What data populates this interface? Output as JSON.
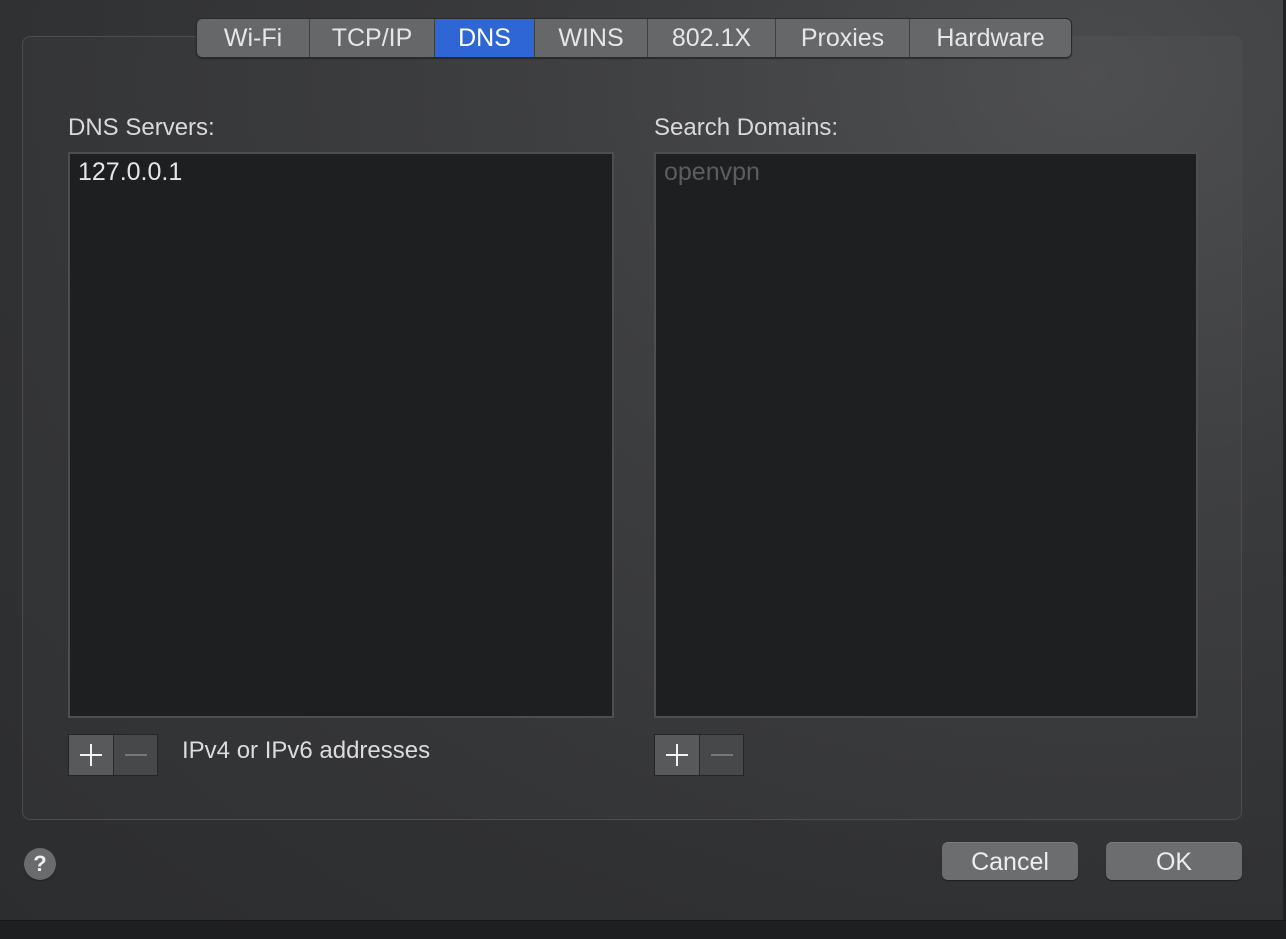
{
  "tabs": [
    {
      "label": "Wi-Fi",
      "active": false
    },
    {
      "label": "TCP/IP",
      "active": false
    },
    {
      "label": "DNS",
      "active": true
    },
    {
      "label": "WINS",
      "active": false
    },
    {
      "label": "802.1X",
      "active": false
    },
    {
      "label": "Proxies",
      "active": false
    },
    {
      "label": "Hardware",
      "active": false
    }
  ],
  "dns": {
    "label": "DNS Servers:",
    "entries": [
      "127.0.0.1"
    ],
    "hint": "IPv4 or IPv6 addresses"
  },
  "search": {
    "label": "Search Domains:",
    "placeholder_entry": "openvpn"
  },
  "footer": {
    "help_label": "?",
    "cancel_label": "Cancel",
    "ok_label": "OK"
  },
  "colors": {
    "accent": "#2f66d6",
    "background": "#323335",
    "list_background": "#1e1f21"
  },
  "icons": {
    "add": "plus-icon",
    "remove": "minus-icon"
  }
}
